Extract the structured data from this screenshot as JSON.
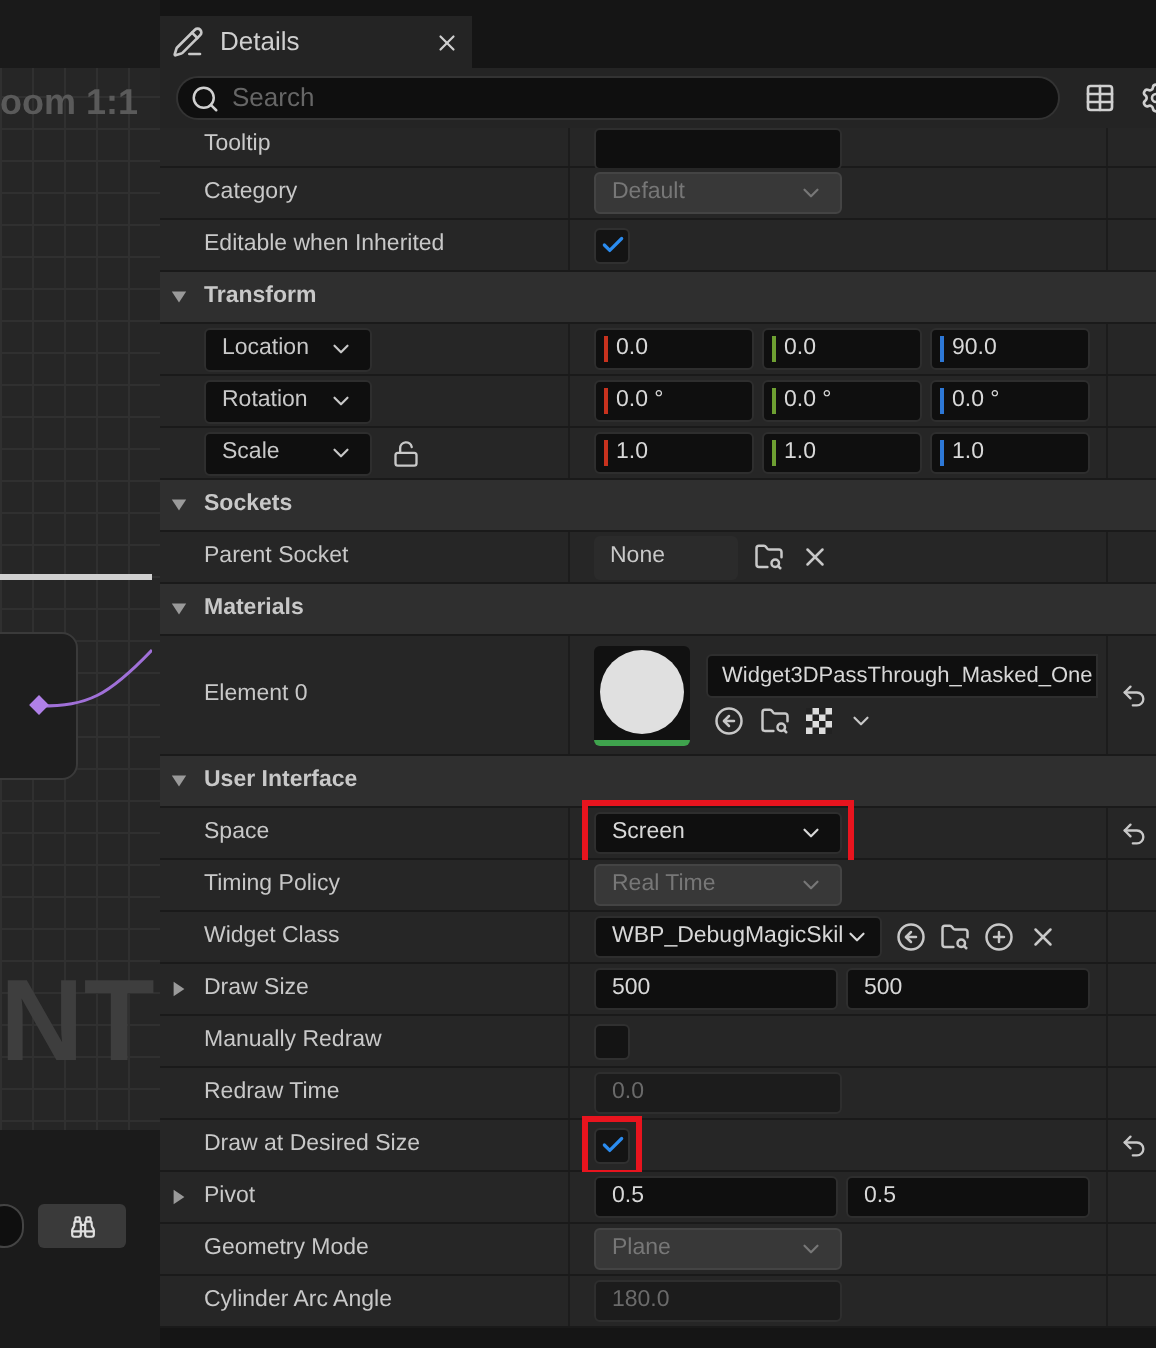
{
  "canvas": {
    "zoom_label": "oom 1:1",
    "viewport_label": "NT"
  },
  "panel": {
    "tab": {
      "title": "Details",
      "selected": true
    },
    "search": {
      "placeholder": "Search"
    }
  },
  "rows": [
    {
      "kind": "text",
      "label": "Tooltip",
      "disabled": false
    },
    {
      "kind": "dropdown",
      "label": "Category",
      "value": "Default",
      "disabled": true
    },
    {
      "kind": "checkbox",
      "label": "Editable when Inherited",
      "checked": true
    },
    {
      "kind": "header",
      "label": "Transform",
      "expanded": true
    },
    {
      "kind": "vector",
      "label": "Location",
      "components": [
        {
          "value": "0.0",
          "color": "#c8321e"
        },
        {
          "value": "0.0",
          "color": "#6ea032"
        },
        {
          "value": "90.0",
          "color": "#2d78d7"
        }
      ]
    },
    {
      "kind": "vector",
      "label": "Rotation",
      "components": [
        {
          "value": "0.0 °",
          "color": "#c8321e"
        },
        {
          "value": "0.0 °",
          "color": "#6ea032"
        },
        {
          "value": "0.0 °",
          "color": "#2d78d7"
        }
      ]
    },
    {
      "kind": "vector",
      "label": "Scale",
      "locked": false,
      "components": [
        {
          "value": "1.0",
          "color": "#c8321e"
        },
        {
          "value": "1.0",
          "color": "#6ea032"
        },
        {
          "value": "1.0",
          "color": "#2d78d7"
        }
      ]
    },
    {
      "kind": "header",
      "label": "Sockets",
      "expanded": true
    },
    {
      "kind": "asset",
      "label": "Parent Socket",
      "value": "None"
    },
    {
      "kind": "header",
      "label": "Materials",
      "expanded": true
    },
    {
      "kind": "material",
      "label": "Element 0",
      "value": "Widget3DPassThrough_Masked_One",
      "reset": true
    },
    {
      "kind": "header",
      "label": "User Interface",
      "expanded": true
    },
    {
      "kind": "dropdown",
      "label": "Space",
      "value": "Screen",
      "disabled": false,
      "highlighted": true,
      "reset": true
    },
    {
      "kind": "dropdown",
      "label": "Timing Policy",
      "value": "Real Time",
      "disabled": true
    },
    {
      "kind": "class",
      "label": "Widget Class",
      "value": "WBP_DebugMagicSkil"
    },
    {
      "kind": "pair",
      "label": "Draw Size",
      "expanded": false,
      "values": [
        "500",
        "500"
      ]
    },
    {
      "kind": "checkbox",
      "label": "Manually Redraw",
      "checked": false
    },
    {
      "kind": "text",
      "label": "Redraw Time",
      "value": "0.0",
      "disabled": true
    },
    {
      "kind": "checkbox",
      "label": "Draw at Desired Size",
      "checked": true,
      "highlighted": true,
      "reset": true
    },
    {
      "kind": "pair",
      "label": "Pivot",
      "expanded": false,
      "values": [
        "0.5",
        "0.5"
      ]
    },
    {
      "kind": "dropdown",
      "label": "Geometry Mode",
      "value": "Plane",
      "disabled": true
    },
    {
      "kind": "text",
      "label": "Cylinder Arc Angle",
      "value": "180.0",
      "disabled": true
    }
  ]
}
